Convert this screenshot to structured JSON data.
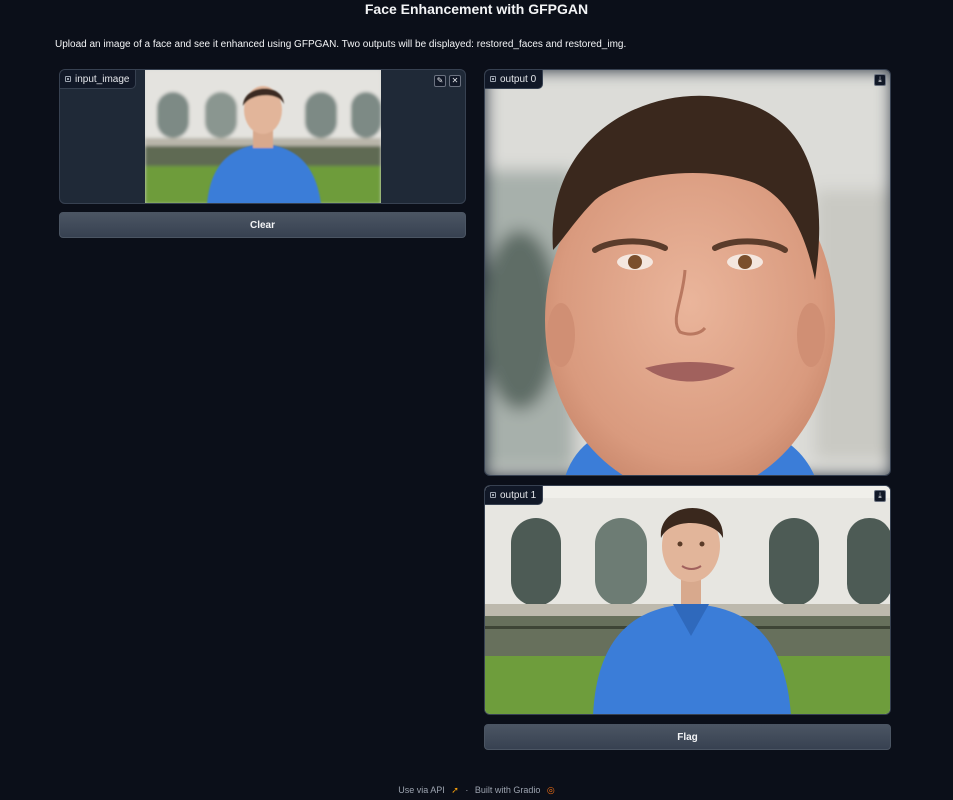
{
  "header": {
    "title": "Face Enhancement with GFPGAN",
    "description": "Upload an image of a face and see it enhanced using GFPGAN. Two outputs will be displayed: restored_faces and restored_img."
  },
  "input_panel": {
    "label": "input_image",
    "edit_icon": "pencil-icon",
    "clear_icon": "close-icon"
  },
  "clear_button": {
    "label": "Clear"
  },
  "outputs": [
    {
      "label": "output 0",
      "download_icon": "download-icon"
    },
    {
      "label": "output 1",
      "download_icon": "download-icon"
    }
  ],
  "flag_button": {
    "label": "Flag"
  },
  "footer": {
    "api_link": "Use via API",
    "separator": "·",
    "built_with": "Built with Gradio"
  },
  "colors": {
    "background": "#0b0f19",
    "panel": "#1f2937",
    "border": "#374151",
    "shirt_blue": "#3b7dd8",
    "grass": "#6a9b3c"
  }
}
